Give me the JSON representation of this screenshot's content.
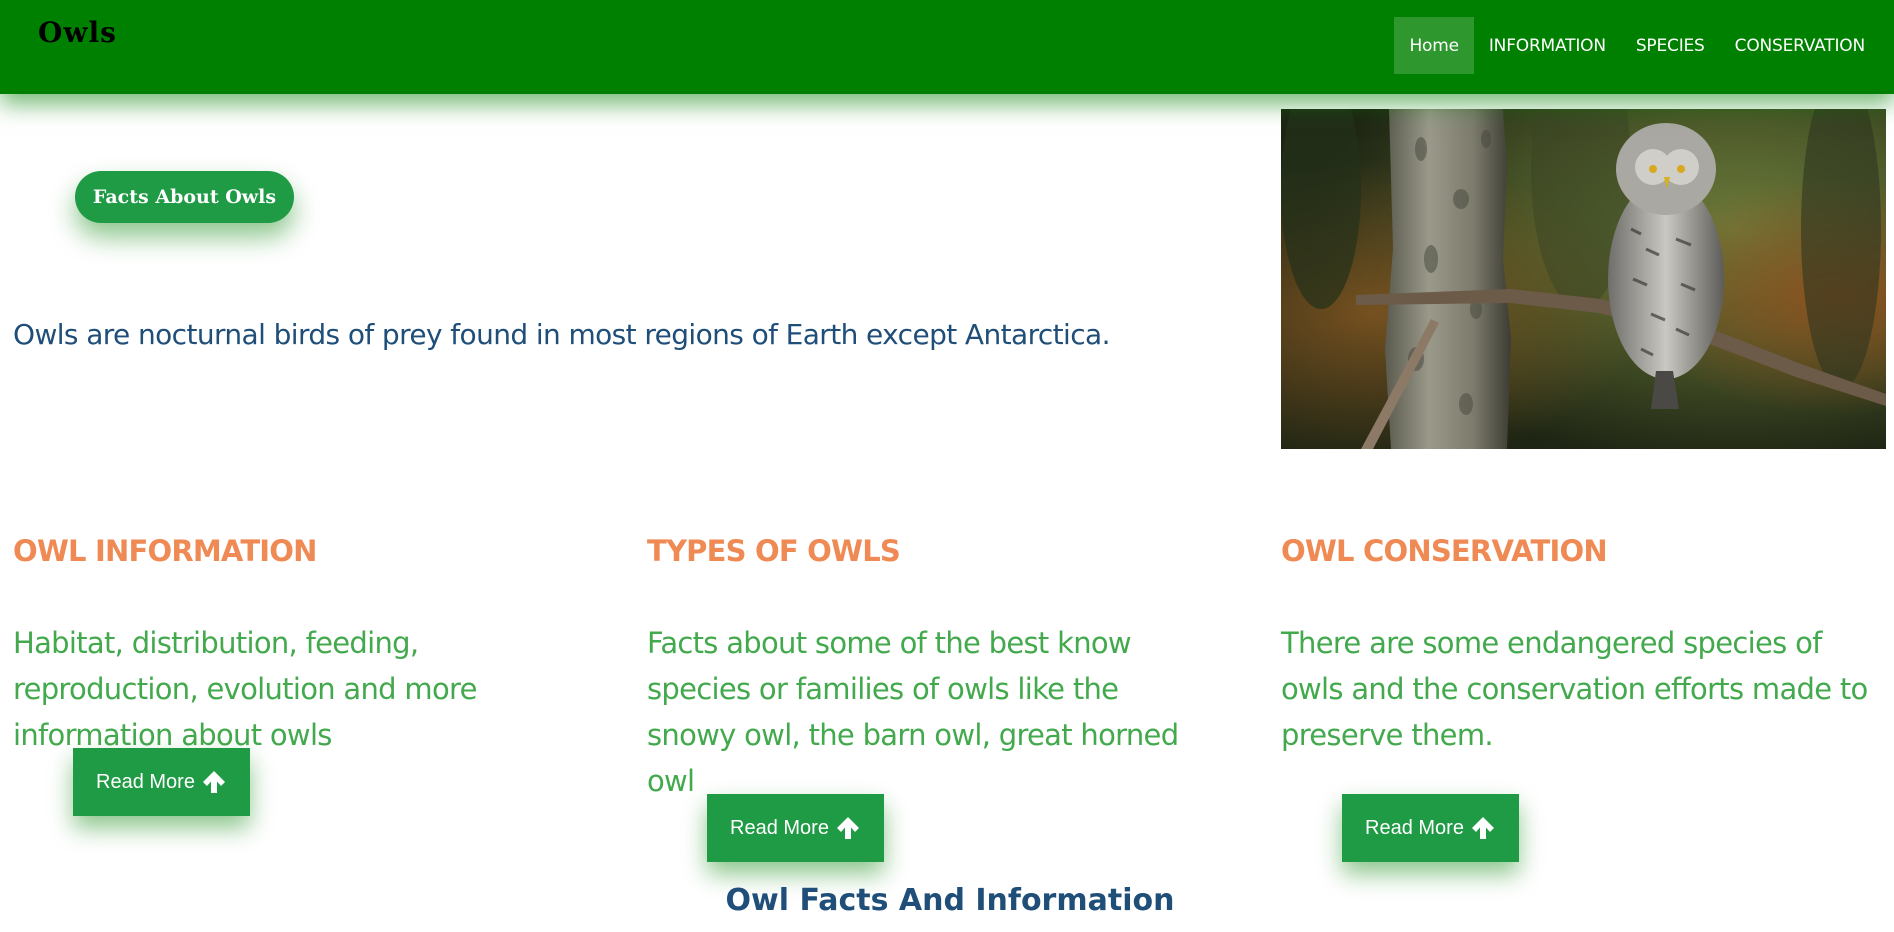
{
  "header": {
    "brand": "Owls",
    "nav": [
      {
        "label": "Home",
        "active": true
      },
      {
        "label": "INFORMATION",
        "active": false
      },
      {
        "label": "SPECIES",
        "active": false
      },
      {
        "label": "CONSERVATION",
        "active": false
      }
    ]
  },
  "hero": {
    "button_label": "Facts About Owls",
    "intro": "Owls are nocturnal birds of prey found in most regions of Earth except Antarctica.",
    "image_subject": "great grey owl perched on a branch beside a tree trunk"
  },
  "sections": [
    {
      "title": "OWL INFORMATION",
      "text": "Habitat, distribution, feeding, reproduction, evolution and more information about owls",
      "button_label": "Read More",
      "button_icon": "arrow-up-icon"
    },
    {
      "title": "TYPES OF OWLS",
      "text": "Facts about some of the best know species or families of owls like the snowy owl, the barn owl, great horned owl",
      "button_label": "Read More",
      "button_icon": "arrow-up-icon"
    },
    {
      "title": "OWL CONSERVATION",
      "text": "There are some endangered species of owls and the conservation efforts made to preserve them.",
      "button_label": "Read More",
      "button_icon": "arrow-up-icon"
    }
  ],
  "footer": {
    "title": "Owl Facts And Information"
  },
  "colors": {
    "navbar": "#008000",
    "button": "#1f9a45",
    "section_title": "#ef8a55",
    "section_text": "#43a94d",
    "intro_text": "#1f4e79"
  }
}
